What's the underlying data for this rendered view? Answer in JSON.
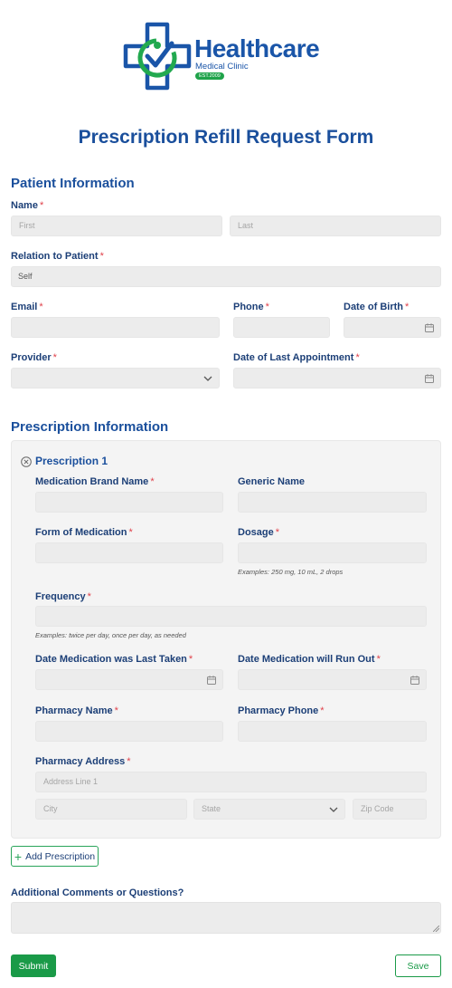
{
  "logo": {
    "title": "Healthcare",
    "subtitle": "Medical Clinic",
    "est": "EST.2009"
  },
  "colors": {
    "brand_blue": "#1a4f9c",
    "brand_green": "#1a9a48",
    "required": "#e0414a",
    "field_bg": "#ececec"
  },
  "form": {
    "title": "Prescription Refill Request Form"
  },
  "patient": {
    "section_title": "Patient Information",
    "name_label": "Name",
    "first_placeholder": "First",
    "last_placeholder": "Last",
    "relation_label": "Relation to Patient",
    "relation_value": "Self",
    "email_label": "Email",
    "phone_label": "Phone",
    "dob_label": "Date of Birth",
    "provider_label": "Provider",
    "last_appt_label": "Date of Last Appointment"
  },
  "prescription": {
    "section_title": "Prescription Information",
    "item_title": "Prescription 1",
    "brand_label": "Medication Brand Name",
    "generic_label": "Generic Name",
    "form_label": "Form of Medication",
    "dosage_label": "Dosage",
    "dosage_hint": "Examples: 250 mg, 10 mL, 2 drops",
    "frequency_label": "Frequency",
    "frequency_hint": "Examples: twice per day, once per day, as needed",
    "last_taken_label": "Date Medication was Last Taken",
    "run_out_label": "Date Medication will Run Out",
    "pharmacy_name_label": "Pharmacy Name",
    "pharmacy_phone_label": "Pharmacy Phone",
    "pharmacy_address_label": "Pharmacy Address",
    "address_line1_placeholder": "Address Line 1",
    "city_placeholder": "City",
    "state_placeholder": "State",
    "zip_placeholder": "Zip Code",
    "add_button": "Add Prescription"
  },
  "comments": {
    "label": "Additional Comments or Questions?"
  },
  "actions": {
    "submit": "Submit",
    "save": "Save"
  },
  "icons": {
    "logo": "medical-cross-logo-icon",
    "calendar": "calendar-icon",
    "dropdown": "chevron-down-icon",
    "remove": "close-circle-icon",
    "add": "plus-icon"
  }
}
